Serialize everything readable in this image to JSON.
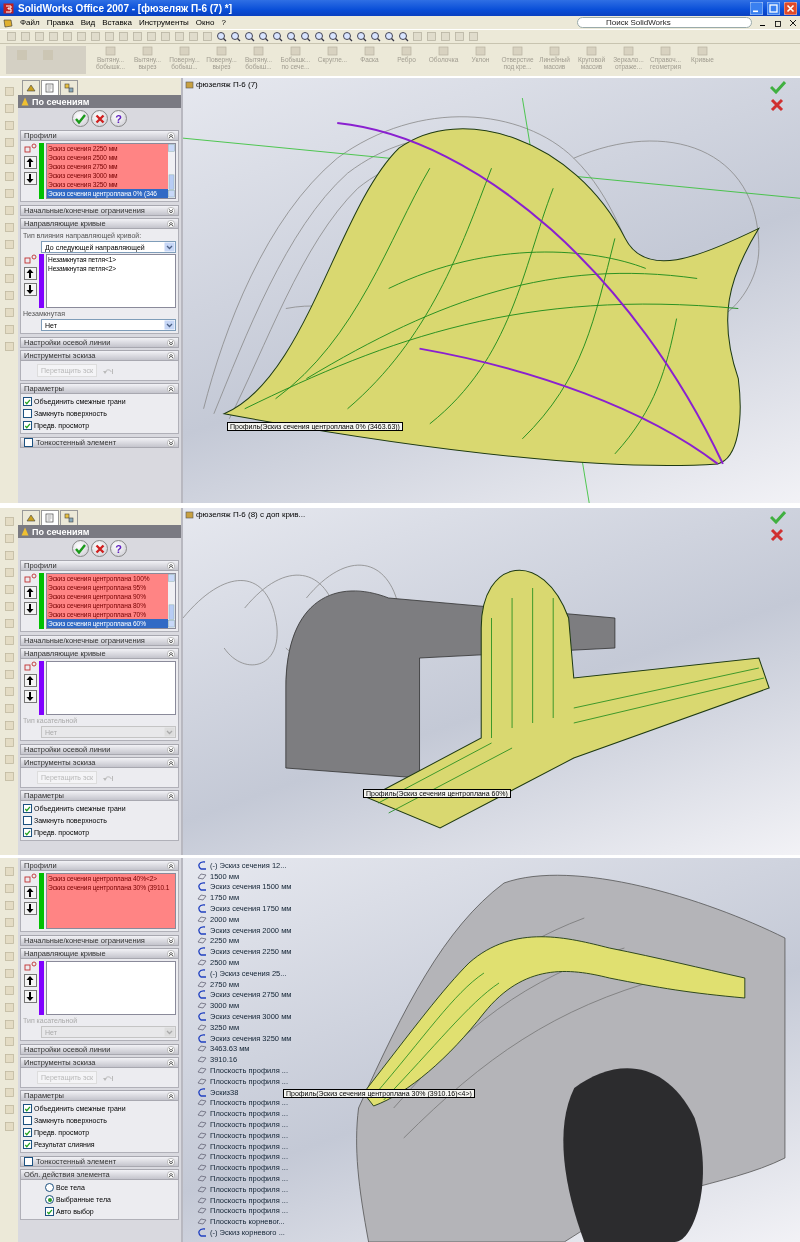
{
  "window": {
    "title": "SolidWorks Office 2007 - [фюзеляж П-6 (7) *]"
  },
  "menu": [
    "Файл",
    "Правка",
    "Вид",
    "Вставка",
    "Инструменты",
    "Окно",
    "?"
  ],
  "search": {
    "placeholder": "Поиск SolidWorks"
  },
  "feature_toolbar": [
    "Вытяну... бобышк...",
    "Вытяну... вырез",
    "Поверну... бобыш...",
    "Поверну... вырез",
    "Вытяну... бобыш...",
    "Бобышк... по сече...",
    "Скругле...",
    "Фаска",
    "Ребро",
    "Оболочка",
    "Уклон",
    "Отверстие под кре...",
    "Линейный массив",
    "Круговой массив",
    "Зеркало... отраже...",
    "Справоч... геометрия",
    "Кривые"
  ],
  "panels": [
    {
      "tabs": [
        {
          "selected": false
        },
        {
          "selected": true
        },
        {
          "selected": false
        }
      ],
      "title": "По сечениям",
      "actions": [
        {
          "kind": "ok"
        },
        {
          "kind": "cancel"
        },
        {
          "kind": "help",
          "text": "?"
        }
      ],
      "sections": [
        {
          "kind": "profiles",
          "title": "Профили",
          "expanded": true,
          "color": "#00c000",
          "items": [
            {
              "text": "Эскиз сечения 2250 мм",
              "selected": false
            },
            {
              "text": "Эскиз сечения 2500 мм",
              "selected": false
            },
            {
              "text": "Эскиз сечения 2750 мм",
              "selected": false
            },
            {
              "text": "Эскиз сечения 3000 мм",
              "selected": false
            },
            {
              "text": "Эскиз сечения 3250 мм",
              "selected": false
            },
            {
              "text": "Эскиз сечения центроплана 0% (346",
              "selected": true
            }
          ]
        },
        {
          "kind": "header",
          "title": "Начальные/конечные ограничения",
          "expanded": false
        },
        {
          "kind": "guides",
          "title": "Направляющие кривые",
          "expanded": true,
          "color": "#8000ff",
          "type_label": "Тип влияния направляющей кривой:",
          "type_value": "До следующей направляющей",
          "items": [
            {
              "text": "Незамкнутая петля<1>",
              "selected": false
            },
            {
              "text": "Незамкнутая петля<2>",
              "selected": false
            }
          ],
          "tangent_label": "Незамкнутая",
          "tangent_value": "Нет",
          "disabled": false
        },
        {
          "kind": "header",
          "title": "Настройки осевой линии",
          "expanded": false
        },
        {
          "kind": "sketch_tools",
          "title": "Инструменты эскиза",
          "expanded": true,
          "button": "Перетащить эск"
        },
        {
          "kind": "options",
          "title": "Параметры",
          "expanded": true,
          "checks": [
            {
              "label": "Объединить смежные грани",
              "checked": true
            },
            {
              "label": "Замкнуть поверхность",
              "checked": false
            },
            {
              "label": "Предв. просмотр",
              "checked": true
            }
          ]
        },
        {
          "kind": "header",
          "title": "Тонкостенный элемент",
          "expanded": false,
          "checked": false
        }
      ],
      "viewport": {
        "title": "фюзеляж П-6 (7)",
        "callout": "Профиль(Эскиз сечения центроплана 0% (3463.63))",
        "confirm": true
      }
    },
    {
      "tabs": [
        {
          "selected": false
        },
        {
          "selected": true
        },
        {
          "selected": false
        }
      ],
      "title": "По сечениям",
      "actions": [
        {
          "kind": "ok"
        },
        {
          "kind": "cancel"
        },
        {
          "kind": "help",
          "text": "?"
        }
      ],
      "sections": [
        {
          "kind": "profiles",
          "title": "Профили",
          "expanded": true,
          "color": "#00c000",
          "items": [
            {
              "text": "Эскиз сечения центроплана 100%",
              "selected": false
            },
            {
              "text": "Эскиз сечения центроплана 95%",
              "selected": false
            },
            {
              "text": "Эскиз сечения центроплана 90%",
              "selected": false
            },
            {
              "text": "Эскиз сечения центроплана 80%",
              "selected": false
            },
            {
              "text": "Эскиз сечения центроплана 70%",
              "selected": false
            },
            {
              "text": "Эскиз сечения центроплана 60%",
              "selected": true
            }
          ]
        },
        {
          "kind": "header",
          "title": "Начальные/конечные ограничения",
          "expanded": false
        },
        {
          "kind": "guides",
          "title": "Направляющие кривые",
          "expanded": true,
          "color": "#8000ff",
          "tangent_label": "Тип касательной",
          "tangent_value": "Нет",
          "disabled": true
        },
        {
          "kind": "header",
          "title": "Настройки осевой линии",
          "expanded": false
        },
        {
          "kind": "sketch_tools",
          "title": "Инструменты эскиза",
          "expanded": true,
          "button": "Перетащить эск"
        },
        {
          "kind": "options",
          "title": "Параметры",
          "expanded": true,
          "checks": [
            {
              "label": "Объединить смежные грани",
              "checked": true
            },
            {
              "label": "Замкнуть поверхность",
              "checked": false
            },
            {
              "label": "Предв. просмотр",
              "checked": true
            }
          ]
        }
      ],
      "viewport": {
        "title": "фюзеляж П-6 (8) с доп крив...",
        "callout": "Профиль(Эскиз сечения центроплана 60%)",
        "confirm": true
      }
    },
    {
      "sections": [
        {
          "kind": "profiles",
          "title": "Профили",
          "expanded": true,
          "color": "#00c000",
          "items": [
            {
              "text": "Эскиз сечения центроплана 40%<2>",
              "selected": false
            },
            {
              "text": "Эскиз сечения центроплана 30% (3910.1",
              "selected": false
            }
          ]
        },
        {
          "kind": "header",
          "title": "Начальные/конечные ограничения",
          "expanded": false
        },
        {
          "kind": "guides",
          "title": "Направляющие кривые",
          "expanded": true,
          "color": "#8000ff",
          "tangent_label": "Тип касательной",
          "tangent_value": "Нет",
          "disabled": true
        },
        {
          "kind": "header",
          "title": "Настройки осевой линии",
          "expanded": false
        },
        {
          "kind": "sketch_tools",
          "title": "Инструменты эскиза",
          "expanded": true,
          "button": "Перетащить эск"
        },
        {
          "kind": "options",
          "title": "Параметры",
          "expanded": true,
          "checks": [
            {
              "label": "Объединить смежные грани",
              "checked": true
            },
            {
              "label": "Замкнуть поверхность",
              "checked": false
            },
            {
              "label": "Предв. просмотр",
              "checked": true
            },
            {
              "label": "Результат слияния",
              "checked": true
            }
          ]
        },
        {
          "kind": "header",
          "title": "Тонкостенный элемент",
          "expanded": false,
          "checked": false
        },
        {
          "kind": "scope",
          "title": "Обл. действия элемента",
          "expanded": true,
          "radios": [
            {
              "label": "Все тела",
              "selected": false
            },
            {
              "label": "Выбранные тела",
              "selected": true
            }
          ],
          "checks": [
            {
              "label": "Авто выбор",
              "checked": true
            }
          ]
        }
      ],
      "viewport": {
        "callout": "Профиль(Эскиз сечения  центроплана 30% (3910.16)<4>)",
        "confirm": false,
        "tree": [
          {
            "kind": "sketch",
            "text": "(-) Эскиз сечения 12..."
          },
          {
            "kind": "plane",
            "text": "1500 мм"
          },
          {
            "kind": "sketch",
            "text": "Эскиз сечения 1500 мм"
          },
          {
            "kind": "plane",
            "text": "1750 мм"
          },
          {
            "kind": "sketch",
            "text": "Эскиз сечения 1750 мм"
          },
          {
            "kind": "plane",
            "text": "2000 мм"
          },
          {
            "kind": "sketch",
            "text": "Эскиз сечения 2000 мм"
          },
          {
            "kind": "plane",
            "text": "2250 мм"
          },
          {
            "kind": "sketch",
            "text": "Эскиз сечения 2250 мм"
          },
          {
            "kind": "plane",
            "text": "2500 мм"
          },
          {
            "kind": "sketch",
            "text": "(-) Эскиз сечения 25..."
          },
          {
            "kind": "plane",
            "text": "2750 мм"
          },
          {
            "kind": "sketch",
            "text": "Эскиз сечения 2750 мм"
          },
          {
            "kind": "plane",
            "text": "3000 мм"
          },
          {
            "kind": "sketch",
            "text": "Эскиз сечения 3000 мм"
          },
          {
            "kind": "plane",
            "text": "3250 мм"
          },
          {
            "kind": "sketch",
            "text": "Эскиз сечения 3250 мм"
          },
          {
            "kind": "plane",
            "text": "3463.63 мм"
          },
          {
            "kind": "plane",
            "text": "3910.16"
          },
          {
            "kind": "plane",
            "text": "Плоскость профиля ..."
          },
          {
            "kind": "plane",
            "text": "Плоскость профиля ..."
          },
          {
            "kind": "sketch",
            "text": "Эскиз38"
          },
          {
            "kind": "plane",
            "text": "Плоскость профиля ..."
          },
          {
            "kind": "plane",
            "text": "Плоскость профиля ..."
          },
          {
            "kind": "plane",
            "text": "Плоскость профиля ..."
          },
          {
            "kind": "plane",
            "text": "Плоскость профиля ..."
          },
          {
            "kind": "plane",
            "text": "Плоскость профиля ..."
          },
          {
            "kind": "plane",
            "text": "Плоскость профиля ..."
          },
          {
            "kind": "plane",
            "text": "Плоскость профиля ..."
          },
          {
            "kind": "plane",
            "text": "Плоскость профиля ..."
          },
          {
            "kind": "plane",
            "text": "Плоскость профиля ..."
          },
          {
            "kind": "plane",
            "text": "Плоскость профиля ..."
          },
          {
            "kind": "plane",
            "text": "Плоскость профиля ..."
          },
          {
            "kind": "plane",
            "text": "Плоскость корневог..."
          },
          {
            "kind": "sketch",
            "text": "(-) Эскиз корневого ..."
          }
        ]
      }
    }
  ]
}
